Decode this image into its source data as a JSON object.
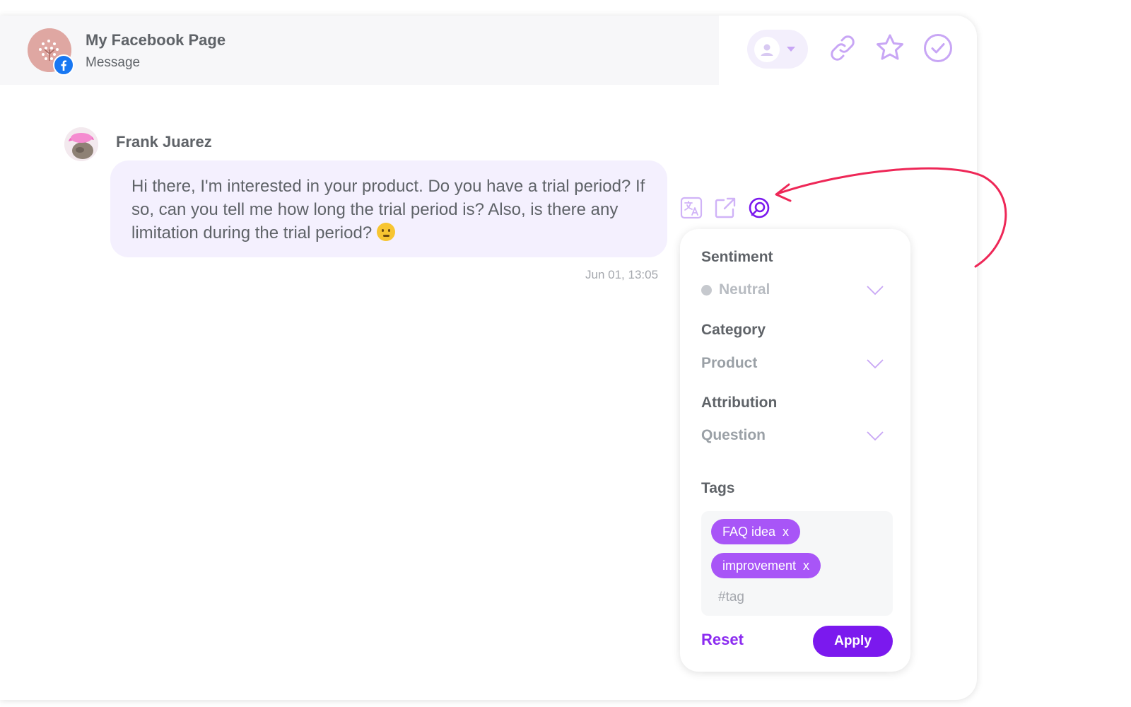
{
  "header": {
    "page_title": "My Facebook Page",
    "page_subtitle": "Message",
    "badge_icon": "facebook-icon",
    "actions": {
      "assignee_icon": "person-icon",
      "link_icon": "link-icon",
      "star_icon": "star-icon",
      "done_icon": "check-circle-icon"
    }
  },
  "message": {
    "sender_name": "Frank Juarez",
    "text": "Hi there, I'm interested in your product. Do you have a trial period? If so, can you tell me how long the trial period is? Also, is there any limitation during the trial period?",
    "emoji": "thinking-face",
    "timestamp": "Jun 01, 13:05",
    "actions": [
      "translate-icon",
      "open-external-icon",
      "tagging-icon"
    ]
  },
  "panel": {
    "sentiment_label": "Sentiment",
    "sentiment_value": "Neutral",
    "category_label": "Category",
    "category_value": "Product",
    "attribution_label": "Attribution",
    "attribution_value": "Question",
    "tags_label": "Tags",
    "tags": [
      {
        "label": "FAQ idea",
        "remove": "x"
      },
      {
        "label": "improvement",
        "remove": "x"
      }
    ],
    "tag_placeholder": "#tag",
    "reset_label": "Reset",
    "apply_label": "Apply"
  },
  "colors": {
    "accent": "#7b19ee",
    "tag": "#a855f7",
    "bubble": "#f4f0fe",
    "annotation_arrow": "#ee2757",
    "icon_tint": "#c8a6f5"
  }
}
